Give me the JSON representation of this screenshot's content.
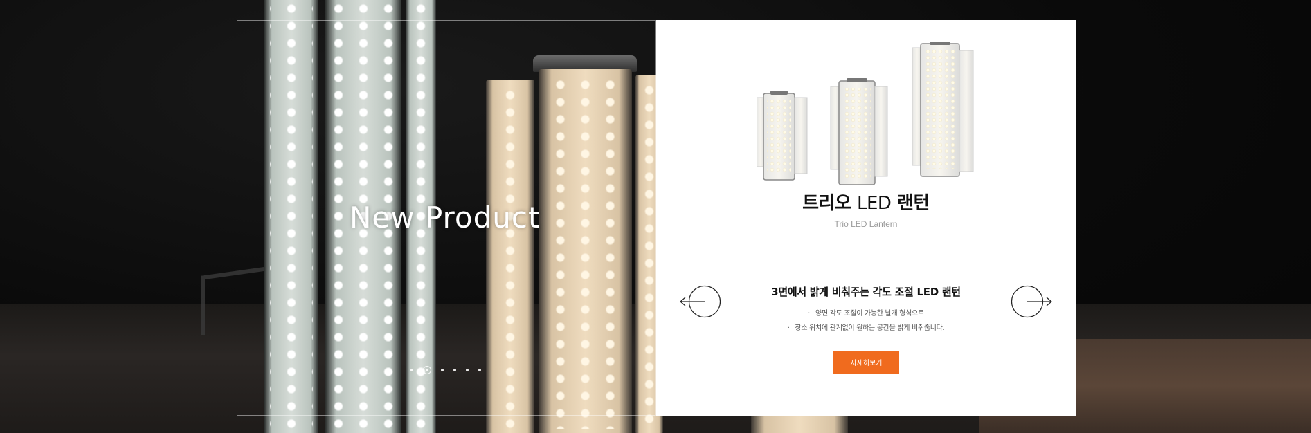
{
  "hero": {
    "headline": "New Product",
    "slides_count": 6,
    "active_slide": 1
  },
  "product": {
    "title_ko_1": "트리오",
    "title_led": "LED",
    "title_ko_2": "랜턴",
    "subtitle": "Trio LED Lantern",
    "description_title": "3면에서 밝게 비춰주는 각도 조절 LED 랜턴",
    "features": [
      "양면 각도 조절이 가능한 날개 형식으로",
      "장소 위치에 관계없이 원하는 공간을 밝게 비춰줍니다."
    ],
    "cta_label": "자세히보기"
  },
  "colors": {
    "accent": "#f06b1e",
    "card_bg": "#ffffff",
    "page_bg": "#0b0b0b"
  },
  "icons": {
    "prev": "arrow-left-circle-icon",
    "next": "arrow-right-circle-icon"
  }
}
